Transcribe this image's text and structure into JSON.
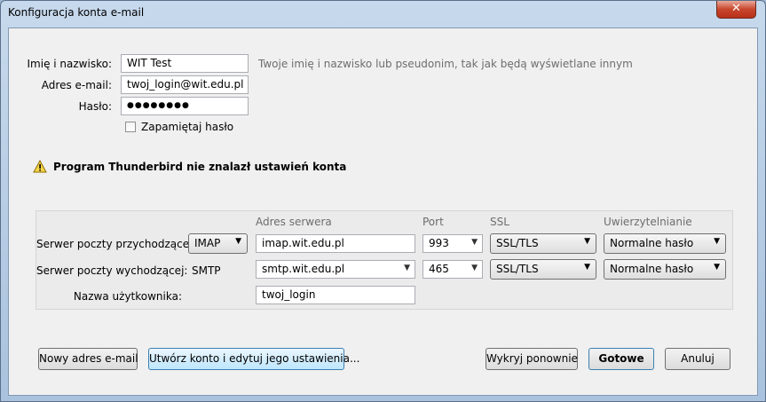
{
  "window": {
    "title": "Konfiguracja konta e-mail",
    "close_glyph": "✕"
  },
  "identity": {
    "name_label": "Imię i nazwisko:",
    "name_value": "WIT Test",
    "name_hint": "Twoje imię i nazwisko lub pseudonim, tak jak będą wyświetlane innym",
    "email_label": "Adres e-mail:",
    "email_value": "twoj_login@wit.edu.pl",
    "password_label": "Hasło:",
    "password_value": "●●●●●●●●",
    "remember_label": "Zapamiętaj hasło",
    "remember_checked": false
  },
  "warning": {
    "icon": "warning-icon",
    "text": "Program Thunderbird nie znalazł ustawień konta"
  },
  "settings": {
    "headers": {
      "server": "Adres serwera",
      "port": "Port",
      "ssl": "SSL",
      "auth": "Uwierzytelnianie"
    },
    "incoming": {
      "label": "Serwer poczty przychodzącej:",
      "protocol": "IMAP",
      "server": "imap.wit.edu.pl",
      "port": "993",
      "ssl": "SSL/TLS",
      "auth": "Normalne hasło"
    },
    "outgoing": {
      "label": "Serwer poczty wychodzącej:",
      "protocol": "SMTP",
      "server": "smtp.wit.edu.pl",
      "port": "465",
      "ssl": "SSL/TLS",
      "auth": "Normalne hasło"
    },
    "username_label": "Nazwa użytkownika:",
    "username_value": "twoj_login"
  },
  "buttons": {
    "new_address": "Nowy adres e-mail",
    "manual": "Utwórz konto i edytuj jego ustawienia...",
    "retest": "Wykryj ponownie",
    "done": "Gotowe",
    "cancel": "Anuluj"
  },
  "colors": {
    "warning_yellow": "#f7d548",
    "accent_blue": "#3c7fb1",
    "close_red": "#c7462b"
  }
}
